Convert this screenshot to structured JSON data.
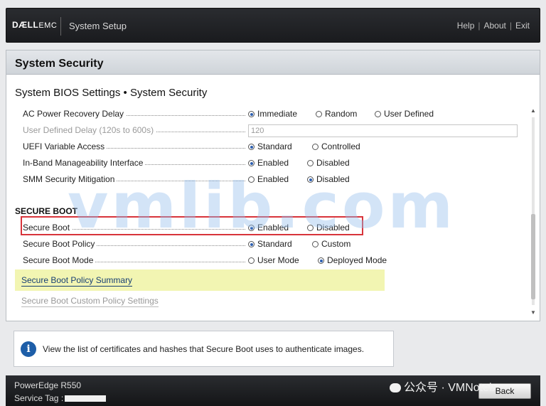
{
  "header": {
    "brand_bold": "DÆLL",
    "brand_light": "EMC",
    "app_title": "System Setup",
    "links": [
      "Help",
      "About",
      "Exit"
    ]
  },
  "panel": {
    "section_title": "System Security",
    "breadcrumb": "System BIOS Settings • System Security"
  },
  "settings": {
    "ac_power": {
      "label": "AC Power Recovery Delay",
      "options": [
        "Immediate",
        "Random",
        "User Defined"
      ],
      "selected": "Immediate"
    },
    "user_delay": {
      "label": "User Defined Delay (120s to 600s)",
      "value": "120",
      "disabled": true
    },
    "uefi_var": {
      "label": "UEFI Variable Access",
      "options": [
        "Standard",
        "Controlled"
      ],
      "selected": "Standard"
    },
    "inband": {
      "label": "In-Band Manageability Interface",
      "options": [
        "Enabled",
        "Disabled"
      ],
      "selected": "Enabled"
    },
    "smm": {
      "label": "SMM Security Mitigation",
      "options": [
        "Enabled",
        "Disabled"
      ],
      "selected": "Disabled"
    },
    "secure_boot_header": "SECURE BOOT",
    "secure_boot": {
      "label": "Secure Boot",
      "options": [
        "Enabled",
        "Disabled"
      ],
      "selected": "Enabled"
    },
    "sb_policy": {
      "label": "Secure Boot Policy",
      "options": [
        "Standard",
        "Custom"
      ],
      "selected": "Standard"
    },
    "sb_mode": {
      "label": "Secure Boot Mode",
      "options": [
        "User Mode",
        "Deployed Mode"
      ],
      "selected": "Deployed Mode"
    },
    "policy_summary_link": "Secure Boot Policy Summary",
    "custom_settings_link": "Secure Boot Custom Policy Settings"
  },
  "info": {
    "icon": "info-icon",
    "text": "View the list of certificates and hashes that Secure Boot uses to authenticate images."
  },
  "footer": {
    "model": "PowerEdge R550",
    "service_tag_label": "Service Tag :",
    "back_label": "Back"
  },
  "watermarks": {
    "main": "vmlib.com",
    "wechat": "公众号 · VMNoteb"
  }
}
